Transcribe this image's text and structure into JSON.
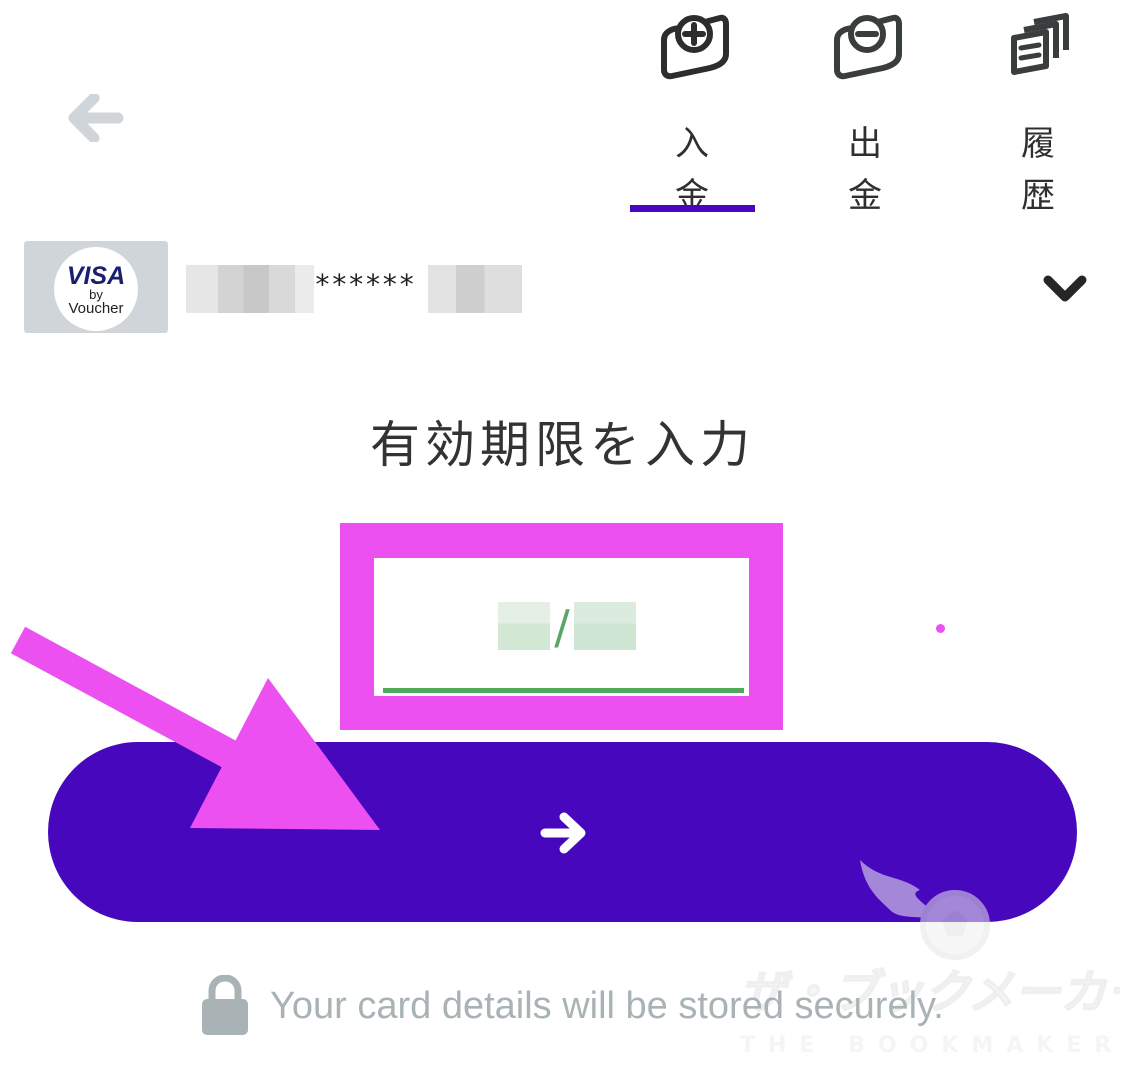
{
  "header": {
    "back_icon": "arrow-left-icon",
    "tabs": [
      {
        "label": "入\n金",
        "icon": "wallet-plus-icon",
        "active": true
      },
      {
        "label": "出\n金",
        "icon": "wallet-minus-icon",
        "active": false
      },
      {
        "label": "履\n歴",
        "icon": "history-documents-icon",
        "active": false
      }
    ],
    "active_color": "#4a05c0"
  },
  "card_selector": {
    "logo": {
      "brand": "VISA",
      "by": "by",
      "name": "Voucher"
    },
    "masked_number": "******",
    "chevron_icon": "chevron-down-icon"
  },
  "main": {
    "title": "有効期限を入力",
    "expiry": {
      "separator": "/"
    },
    "button_icon": "arrow-right-icon",
    "button_color": "#4707bc"
  },
  "annotations": {
    "highlight_color": "#ec50f0"
  },
  "watermark": {
    "line1": "ザ・ブックメーカーズ",
    "line2": "THE BOOKMAKERS"
  },
  "footer": {
    "lock_icon": "lock-icon",
    "secure_text": "Your card details will be stored securely."
  }
}
